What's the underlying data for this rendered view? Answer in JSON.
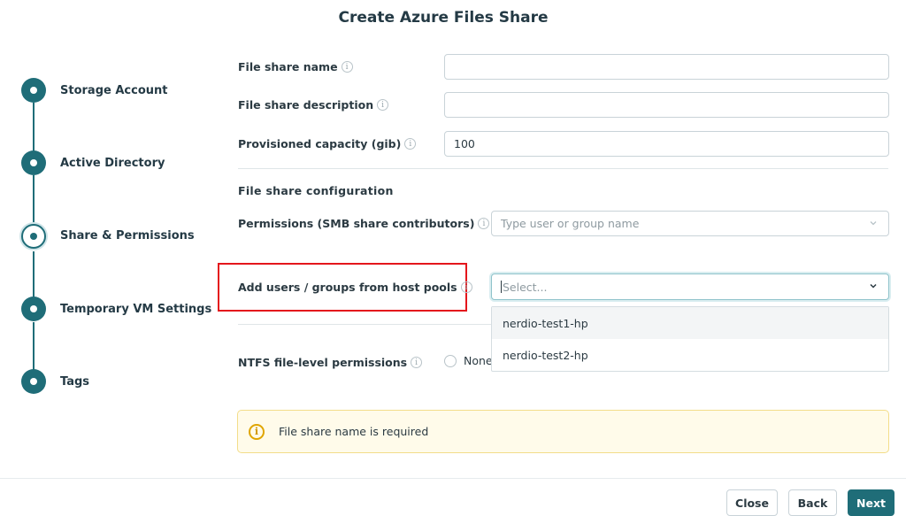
{
  "page": {
    "title": "Create Azure Files Share"
  },
  "steps": [
    {
      "label": "Storage Account",
      "state": "complete"
    },
    {
      "label": "Active Directory",
      "state": "complete"
    },
    {
      "label": "Share & Permissions",
      "state": "current"
    },
    {
      "label": "Temporary VM Settings",
      "state": "pending"
    },
    {
      "label": "Tags",
      "state": "pending"
    }
  ],
  "form": {
    "file_share_name": {
      "label": "File share name",
      "value": ""
    },
    "file_share_description": {
      "label": "File share description",
      "value": ""
    },
    "provisioned_capacity": {
      "label": "Provisioned capacity (gib)",
      "value": "100"
    },
    "config_section": "File share configuration",
    "permissions": {
      "label": "Permissions (SMB share contributors)",
      "placeholder": "Type user or group name"
    },
    "host_pools": {
      "label": "Add users / groups from host pools",
      "placeholder": "Select...",
      "options": [
        "nerdio-test1-hp",
        "nerdio-test2-hp"
      ]
    },
    "ntfs": {
      "label": "NTFS file-level permissions",
      "option": "None"
    }
  },
  "alert": {
    "text": "File share name is required",
    "icon": "info-icon"
  },
  "footer": {
    "close": "Close",
    "back": "Back",
    "next": "Next"
  },
  "colors": {
    "accent": "#1f6d78",
    "highlight": "#e4161c",
    "alert_bg": "#fffbea"
  }
}
